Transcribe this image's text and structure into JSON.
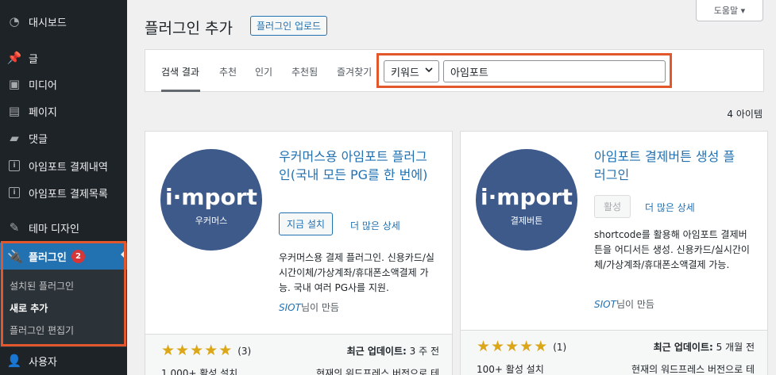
{
  "sidebar": {
    "items": [
      {
        "label": "대시보드",
        "icon": "dashboard-icon"
      },
      {
        "label": "글",
        "icon": "pin-icon"
      },
      {
        "label": "미디어",
        "icon": "media-icon"
      },
      {
        "label": "페이지",
        "icon": "page-icon"
      },
      {
        "label": "댓글",
        "icon": "comment-icon"
      },
      {
        "label": "아임포트 결제내역",
        "icon": "iamport-icon"
      },
      {
        "label": "아임포트 결제목록",
        "icon": "iamport-icon"
      },
      {
        "label": "테마 디자인",
        "icon": "brush-icon"
      },
      {
        "label": "플러그인",
        "icon": "plugin-icon",
        "badge": "2"
      },
      {
        "label": "사용자",
        "icon": "user-icon"
      }
    ],
    "submenu": [
      "설치된 플러그인",
      "새로 추가",
      "플러그인 편집기"
    ]
  },
  "header": {
    "title": "플러그인 추가",
    "upload_label": "플러그인 업로드",
    "help_label": "도움말 ▾"
  },
  "filter": {
    "tabs": [
      "검색 결과",
      "추천",
      "인기",
      "추천됨",
      "즐겨찾기"
    ],
    "select_value": "키워드",
    "search_value": "아임포트"
  },
  "item_count": "4 아이템",
  "cards": [
    {
      "logo_text": "i·mport",
      "logo_sub": "우커머스",
      "title": "우커머스용 아임포트 플러그인(국내 모든 PG를 한 번에)",
      "action_label": "지금 설치",
      "more_label": "더 많은 상세",
      "description": "우커머스용 결제 플러그인. 신용카드/실시간이체/가상계좌/휴대폰소액결제 가능. 국내 여러 PG사를 지원.",
      "author_name": "SIOT",
      "author_suffix": "님이 만듬",
      "rating_count": "(3)",
      "installs": "1,000+ 활성 설치",
      "updated_label": "최근 업데이트:",
      "updated_value": "3 주 전",
      "compat": "현재의 워드프레스 버전으로 테"
    },
    {
      "logo_text": "i·mport",
      "logo_sub": "결제버튼",
      "title": "아임포트 결제버튼 생성 플러그인",
      "action_label": "활성",
      "more_label": "더 많은 상세",
      "description": "shortcode를 활용해 아임포트 결제버튼을 어디서든 생성. 신용카드/실시간이체/가상계좌/휴대폰소액결제 가능.",
      "author_name": "SIOT",
      "author_suffix": "님이 만듬",
      "rating_count": "(1)",
      "installs": "100+ 활성 설치",
      "updated_label": "최근 업데이트:",
      "updated_value": "5 개월 전",
      "compat": "현재의 워드프레스 버전으로 테"
    }
  ],
  "colors": {
    "sidebar_bg": "#1d2327",
    "accent": "#2271b1",
    "highlight": "#e2582c",
    "star": "#dba617",
    "logo_bg": "#3d5a8a"
  }
}
